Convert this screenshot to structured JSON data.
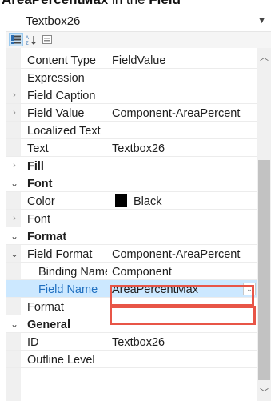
{
  "caption": {
    "prefix": "AreaPercentMax",
    "middle": " in the ",
    "suffix": "Field"
  },
  "object_selector": {
    "value": "Textbox26"
  },
  "toolbar": {
    "categorized": "categorized-icon",
    "alphabetical": "alphabetical-icon",
    "pages": "property-pages-icon"
  },
  "properties": [
    {
      "name": "Content Type",
      "value": "FieldValue",
      "kind": "prop"
    },
    {
      "name": "Expression",
      "value": "",
      "kind": "prop"
    },
    {
      "name": "Field Caption",
      "value": "",
      "kind": "prop",
      "expander": "›"
    },
    {
      "name": "Field Value",
      "value": "Component-AreaPercent",
      "kind": "prop",
      "expander": "›"
    },
    {
      "name": "Localized Text",
      "value": "",
      "kind": "prop"
    },
    {
      "name": "Text",
      "value": "Textbox26",
      "kind": "prop"
    },
    {
      "name": "Fill",
      "value": "",
      "kind": "cat",
      "expander": "›"
    },
    {
      "name": "Font",
      "value": "",
      "kind": "cat",
      "expander": "⌄"
    },
    {
      "name": "Color",
      "value": "Black",
      "kind": "prop",
      "swatch": "#000000"
    },
    {
      "name": "Font",
      "value": "",
      "kind": "prop",
      "expander": "›"
    },
    {
      "name": "Format",
      "value": "",
      "kind": "cat",
      "expander": "⌄"
    },
    {
      "name": "Field Format",
      "value": "Component-AreaPercent",
      "kind": "prop",
      "expander": "⌄"
    },
    {
      "name": "Binding Name",
      "value": "Component",
      "kind": "sub"
    },
    {
      "name": "Field Name",
      "value": "AreaPercentMax",
      "kind": "sub",
      "selected": true
    },
    {
      "name": "Format",
      "value": "",
      "kind": "prop"
    },
    {
      "name": "General",
      "value": "",
      "kind": "cat",
      "expander": "⌄"
    },
    {
      "name": "ID",
      "value": "Textbox26",
      "kind": "prop"
    },
    {
      "name": "Outline Level",
      "value": "",
      "kind": "prop"
    }
  ],
  "colors": {
    "selection": "#cce8ff",
    "highlight_border": "#e85547",
    "selected_name": "#1f6fc0"
  }
}
